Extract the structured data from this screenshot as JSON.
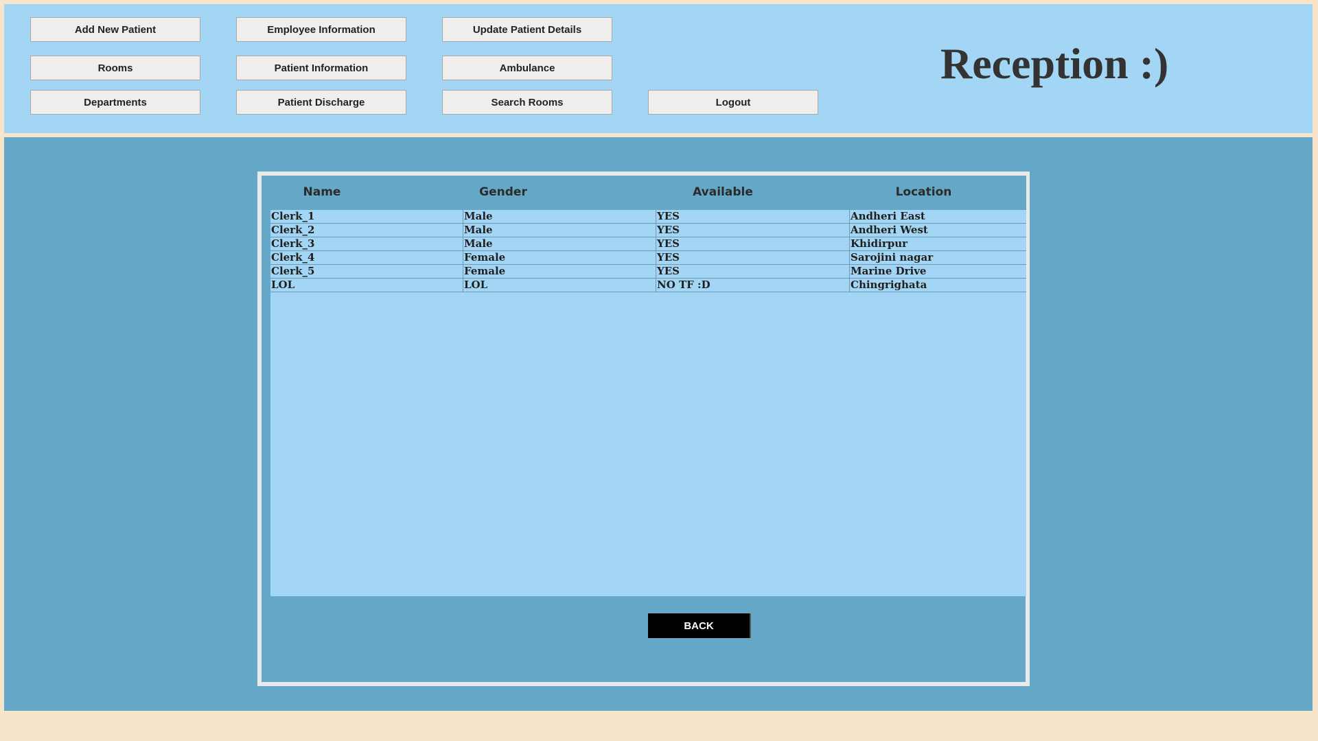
{
  "header": {
    "title": "Reception :)",
    "buttons": {
      "add_new_patient": "Add New Patient",
      "employee_information": "Employee Information",
      "update_patient_details": "Update Patient Details",
      "rooms": "Rooms",
      "patient_information": "Patient Information",
      "ambulance": "Ambulance",
      "departments": "Departments",
      "patient_discharge": "Patient Discharge",
      "search_rooms": "Search Rooms",
      "logout": "Logout"
    }
  },
  "table": {
    "columns": [
      "Name",
      "Gender",
      "Available",
      "Location"
    ],
    "rows": [
      [
        "Clerk_1",
        "Male",
        "YES",
        "Andheri East"
      ],
      [
        "Clerk_2",
        "Male",
        "YES",
        "Andheri West"
      ],
      [
        "Clerk_3",
        "Male",
        "YES",
        "Khidirpur"
      ],
      [
        "Clerk_4",
        "Female",
        "YES",
        "Sarojini nagar"
      ],
      [
        "Clerk_5",
        "Female",
        "YES",
        "Marine Drive"
      ],
      [
        "LOL",
        "LOL",
        "NO TF :D",
        "Chingrighata"
      ]
    ]
  },
  "back_label": "BACK",
  "colors": {
    "page_background": "#f8e3cb",
    "header_background": "#a3d5f4",
    "main_background": "#65a7c7",
    "table_background": "#a3d5f4",
    "back_button": "#000000"
  }
}
